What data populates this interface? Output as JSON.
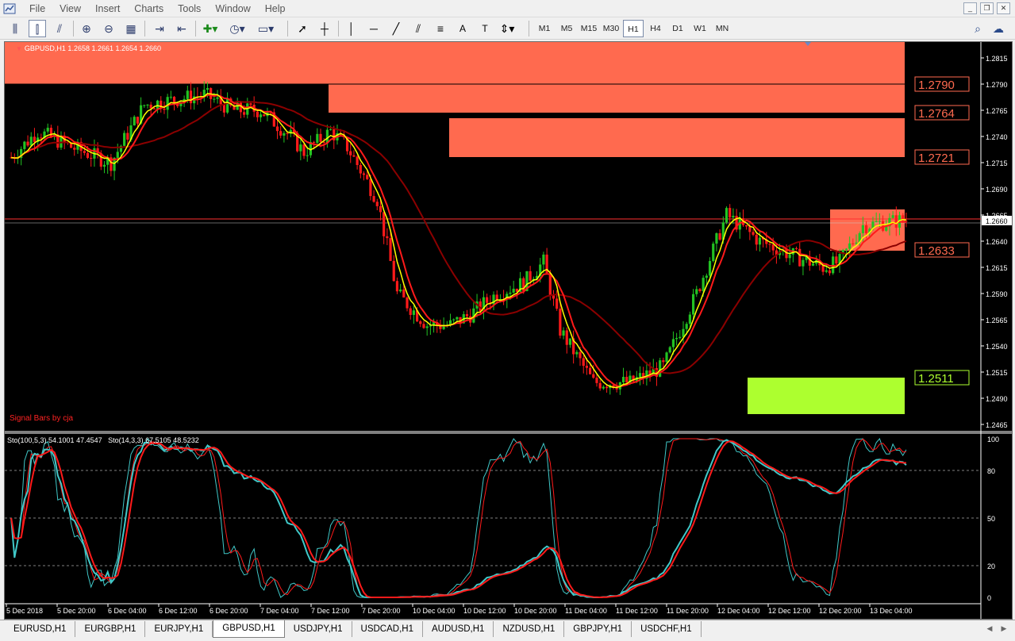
{
  "menu": {
    "items": [
      "File",
      "View",
      "Insert",
      "Charts",
      "Tools",
      "Window",
      "Help"
    ]
  },
  "toolbar": {
    "timeframes": [
      "M1",
      "M5",
      "M15",
      "M30",
      "H1",
      "H4",
      "D1",
      "W1",
      "MN"
    ],
    "active_timeframe": "H1"
  },
  "chart": {
    "symbol_info": "GBPUSD,H1  1.2658 1.2661 1.2654 1.2660",
    "indicator_label": "Signal Bars by cja",
    "stochastic_info": [
      "Sto(100,5,3) 54.1001 47.4547",
      "Sto(14,3,3) 67.5105 48.5232"
    ],
    "current_price": "1.2660",
    "price_ticks": [
      "1.2815",
      "1.2790",
      "1.2765",
      "1.2740",
      "1.2715",
      "1.2690",
      "1.2665",
      "1.2640",
      "1.2615",
      "1.2590",
      "1.2565",
      "1.2540",
      "1.2515",
      "1.2490",
      "1.2465"
    ],
    "osc_ticks": [
      "100",
      "80",
      "50",
      "20",
      "0"
    ],
    "time_labels": [
      "5 Dec 2018",
      "5 Dec 20:00",
      "6 Dec 04:00",
      "6 Dec 12:00",
      "6 Dec 20:00",
      "7 Dec 04:00",
      "7 Dec 12:00",
      "7 Dec 20:00",
      "10 Dec 04:00",
      "10 Dec 12:00",
      "10 Dec 20:00",
      "11 Dec 04:00",
      "11 Dec 12:00",
      "11 Dec 20:00",
      "12 Dec 04:00",
      "12 Dec 12:00",
      "12 Dec 20:00",
      "13 Dec 04:00"
    ],
    "levels": [
      {
        "label": "1.2790",
        "color": "#ff6a4f"
      },
      {
        "label": "1.2764",
        "color": "#ff6a4f"
      },
      {
        "label": "1.2721",
        "color": "#ff6a4f"
      },
      {
        "label": "1.2633",
        "color": "#ff6a4f"
      },
      {
        "label": "1.2511",
        "color": "#adff2f"
      }
    ],
    "colors": {
      "background": "#000000",
      "bull_candle": "#22c322",
      "bear_candle": "#ff1a1a",
      "resistance_zone": "#ff6a4f",
      "support_zone": "#adff2f",
      "ma_fast": "#ffff00",
      "ma_mid": "#ff1a1a",
      "ma_slow": "#8b0000",
      "sto_slow": "#40c8c8",
      "sto_fast": "#ff1a1a"
    }
  },
  "chart_data": {
    "type": "candlestick",
    "symbol": "GBPUSD",
    "timeframe": "H1",
    "ylim": [
      1.2465,
      1.282
    ],
    "series": [
      {
        "name": "price_path",
        "x_index": [
          0,
          8,
          18,
          30,
          40,
          58,
          67,
          75,
          84,
          88,
          96,
          101,
          110,
          116,
          125,
          132,
          138,
          146,
          154,
          160,
          165,
          175,
          186,
          196,
          206,
          215,
          225,
          236,
          244,
          249,
          256,
          268
        ],
        "values": [
          1.272,
          1.2745,
          1.273,
          1.2715,
          1.277,
          1.278,
          1.2765,
          1.2765,
          1.274,
          1.2725,
          1.2745,
          1.273,
          1.268,
          1.259,
          1.256,
          1.256,
          1.257,
          1.259,
          1.26,
          1.262,
          1.2555,
          1.2505,
          1.2505,
          1.252,
          1.259,
          1.2665,
          1.264,
          1.2625,
          1.2615,
          1.262,
          1.2655,
          1.266
        ]
      }
    ],
    "stochastic": {
      "sto_100_5_3": [
        54.1001,
        47.4547
      ],
      "sto_14_3_3": [
        67.5105,
        48.5232
      ],
      "levels": [
        20,
        50,
        80
      ]
    }
  },
  "tabs": {
    "items": [
      "EURUSD,H1",
      "EURGBP,H1",
      "EURJPY,H1",
      "GBPUSD,H1",
      "USDJPY,H1",
      "USDCAD,H1",
      "AUDUSD,H1",
      "NZDUSD,H1",
      "GBPJPY,H1",
      "USDCHF,H1"
    ],
    "active": "GBPUSD,H1"
  }
}
